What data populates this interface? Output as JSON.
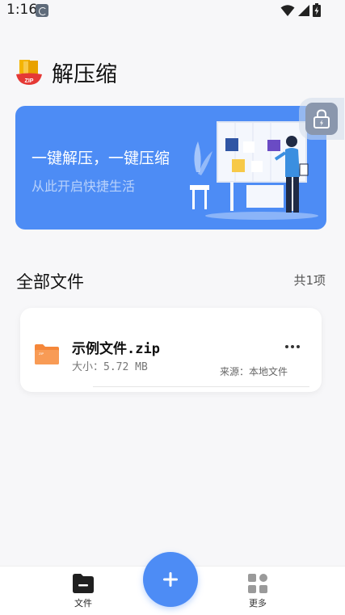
{
  "status_bar": {
    "time": "1:16"
  },
  "header": {
    "title": "解压缩",
    "logo_text": "ZIP"
  },
  "banner": {
    "title": "一键解压，一键压缩",
    "subtitle": "从此开启快捷生活"
  },
  "section": {
    "title": "全部文件",
    "count": "共1项"
  },
  "files": [
    {
      "name": "示例文件.zip",
      "size": "大小：5.72 MB",
      "source": "来源：本地文件"
    }
  ],
  "bottom_nav": {
    "files_label": "文件",
    "more_label": "更多",
    "fab_icon": "plus-icon"
  },
  "colors": {
    "accent": "#4d8cf5",
    "folder": "#f5873a",
    "background": "#f7f7f9"
  }
}
